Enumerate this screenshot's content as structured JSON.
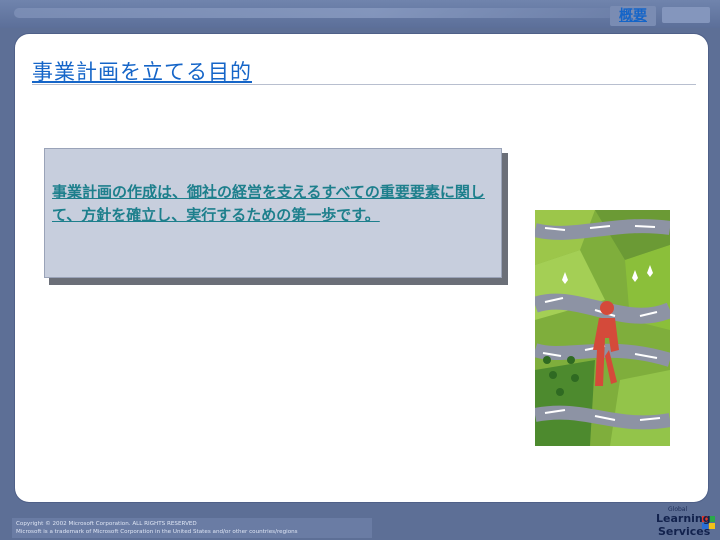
{
  "header": {
    "overview_link": "概要"
  },
  "slide": {
    "title": "事業計画を立てる目的",
    "callout_text": "事業計画の作成は、御社の経営を支えるすべての重要要素に関して、方針を確立し、実行するための第一歩です。"
  },
  "illustration": {
    "icon": "person-walking-road-icon",
    "colors": {
      "grass": "#8bbf3a",
      "road": "#8d93a4",
      "person": "#d44a3a",
      "dark_green": "#3f7a2a"
    }
  },
  "footer": {
    "copyright_line1": "Copyright © 2002 Microsoft Corporation. ALL RIGHTS RESERVED",
    "copyright_line2": "Microsoft is a trademark of Microsoft Corporation in the United States and/or other countries/regions",
    "logo_line1": "Global",
    "logo_line2": "Learning",
    "logo_line3": "Services"
  }
}
